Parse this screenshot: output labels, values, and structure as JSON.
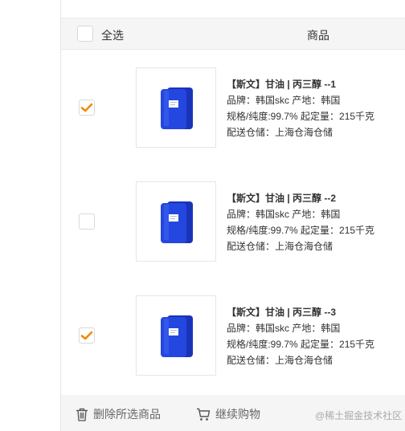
{
  "header": {
    "select_all_label": "全选",
    "product_col_label": "商品"
  },
  "items": [
    {
      "checked": true,
      "title": "【斯文】甘油 | 丙三醇 --1",
      "brand_line": "品牌：韩国skc  产地：韩国",
      "spec_line": "规格/纯度:99.7%  起定量：215千克",
      "warehouse_line": "配送仓储：上海仓海仓储"
    },
    {
      "checked": false,
      "title": "【斯文】甘油 | 丙三醇 --2",
      "brand_line": "品牌：韩国skc  产地：韩国",
      "spec_line": "规格/纯度:99.7%  起定量：215千克",
      "warehouse_line": "配送仓储：上海仓海仓储"
    },
    {
      "checked": true,
      "title": "【斯文】甘油 | 丙三醇 --3",
      "brand_line": "品牌：韩国skc  产地：韩国",
      "spec_line": "规格/纯度:99.7%  起定量：215千克",
      "warehouse_line": "配送仓储：上海仓海仓储"
    }
  ],
  "footer": {
    "delete_label": "删除所选商品",
    "continue_label": "继续购物",
    "watermark": "@稀土掘金技术社区"
  },
  "colors": {
    "check_orange": "#f08c00",
    "drum_blue": "#1f3fd1",
    "header_bg": "#f5f5f5"
  },
  "icons": {
    "delete": "trash-icon",
    "continue": "cart-icon",
    "check": "checkmark-icon",
    "product": "chemical-drum-icon"
  }
}
